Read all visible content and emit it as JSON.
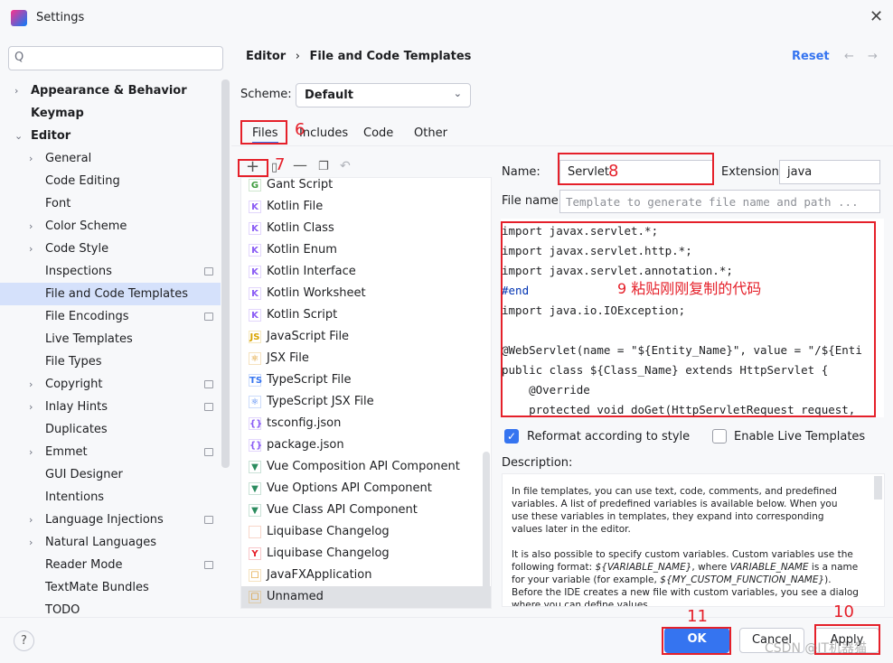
{
  "window": {
    "title": "Settings"
  },
  "search": {
    "placeholder": "Q"
  },
  "sidebar": {
    "items": [
      {
        "label": "Appearance & Behavior",
        "bold": true,
        "chevron": "right",
        "level": 0
      },
      {
        "label": "Keymap",
        "bold": true,
        "level": 0
      },
      {
        "label": "Editor",
        "bold": true,
        "chevron": "down",
        "level": 0
      },
      {
        "label": "General",
        "chevron": "right",
        "level": 1
      },
      {
        "label": "Code Editing",
        "level": 1
      },
      {
        "label": "Font",
        "level": 1
      },
      {
        "label": "Color Scheme",
        "chevron": "right",
        "level": 1
      },
      {
        "label": "Code Style",
        "chevron": "right",
        "level": 1
      },
      {
        "label": "Inspections",
        "badge": true,
        "level": 1
      },
      {
        "label": "File and Code Templates",
        "selected": true,
        "level": 1
      },
      {
        "label": "File Encodings",
        "badge": true,
        "level": 1
      },
      {
        "label": "Live Templates",
        "level": 1
      },
      {
        "label": "File Types",
        "level": 1
      },
      {
        "label": "Copyright",
        "chevron": "right",
        "badge": true,
        "level": 1
      },
      {
        "label": "Inlay Hints",
        "chevron": "right",
        "badge": true,
        "level": 1
      },
      {
        "label": "Duplicates",
        "level": 1
      },
      {
        "label": "Emmet",
        "chevron": "right",
        "badge": true,
        "level": 1
      },
      {
        "label": "GUI Designer",
        "level": 1
      },
      {
        "label": "Intentions",
        "level": 1
      },
      {
        "label": "Language Injections",
        "chevron": "right",
        "badge": true,
        "level": 1
      },
      {
        "label": "Natural Languages",
        "chevron": "right",
        "level": 1
      },
      {
        "label": "Reader Mode",
        "badge": true,
        "level": 1
      },
      {
        "label": "TextMate Bundles",
        "level": 1
      },
      {
        "label": "TODO",
        "level": 1
      }
    ]
  },
  "breadcrumb": {
    "parent": "Editor",
    "sep": "›",
    "current": "File and Code Templates"
  },
  "header": {
    "reset": "Reset"
  },
  "scheme": {
    "label": "Scheme:",
    "value": "Default"
  },
  "tabs": [
    "Files",
    "Includes",
    "Code",
    "Other"
  ],
  "annotations": {
    "a6": "6",
    "a7": "7",
    "a8": "8",
    "a9": "9 粘贴刚刚复制的代码",
    "a10": "10",
    "a11": "11"
  },
  "templates": [
    {
      "label": "Gant Script",
      "icon": "G",
      "color": "#3f9b3f"
    },
    {
      "label": "Kotlin File",
      "icon": "K",
      "color": "#8a5cf5"
    },
    {
      "label": "Kotlin Class",
      "icon": "K",
      "color": "#8a5cf5"
    },
    {
      "label": "Kotlin Enum",
      "icon": "K",
      "color": "#8a5cf5"
    },
    {
      "label": "Kotlin Interface",
      "icon": "K",
      "color": "#8a5cf5"
    },
    {
      "label": "Kotlin Worksheet",
      "icon": "K",
      "color": "#8a5cf5"
    },
    {
      "label": "Kotlin Script",
      "icon": "K",
      "color": "#8a5cf5"
    },
    {
      "label": "JavaScript File",
      "icon": "JS",
      "color": "#d9a400"
    },
    {
      "label": "JSX File",
      "icon": "⚛",
      "color": "#d98a00"
    },
    {
      "label": "TypeScript File",
      "icon": "TS",
      "color": "#3574f0"
    },
    {
      "label": "TypeScript JSX File",
      "icon": "⚛",
      "color": "#3574f0"
    },
    {
      "label": "tsconfig.json",
      "icon": "{}",
      "color": "#8a5cf5"
    },
    {
      "label": "package.json",
      "icon": "{}",
      "color": "#8a5cf5"
    },
    {
      "label": "Vue Composition API Component",
      "icon": "▼",
      "color": "#2c8c5f"
    },
    {
      "label": "Vue Options API Component",
      "icon": "▼",
      "color": "#2c8c5f"
    },
    {
      "label": "Vue Class API Component",
      "icon": "▼",
      "color": "#2c8c5f"
    },
    {
      "label": "Liquibase Changelog",
      "icon": "</>",
      "color": "#e55b2a"
    },
    {
      "label": "Liquibase Changelog",
      "icon": "Y",
      "color": "#e5202a"
    },
    {
      "label": "JavaFXApplication",
      "icon": "☐",
      "color": "#d98a00"
    },
    {
      "label": "Unnamed",
      "icon": "☐",
      "color": "#d98a00",
      "selected": true
    }
  ],
  "form": {
    "name_label": "Name:",
    "name_value": "Servlet",
    "ext_label": "Extension:",
    "ext_value": "java",
    "filename_label": "File name:",
    "filename_placeholder": "Template to generate file name and path ..."
  },
  "code_lines": [
    "import javax.servlet.*;",
    "import javax.servlet.http.*;",
    "import javax.servlet.annotation.*;",
    "#end",
    "import java.io.IOException;",
    "",
    "@WebServlet(name = \"${Entity_Name}\", value = \"/${Enti",
    "public class ${Class_Name} extends HttpServlet {",
    "    @Override",
    "    protected void doGet(HttpServletRequest request,"
  ],
  "options": {
    "reformat": "Reformat according to style",
    "reformat_checked": true,
    "live": "Enable Live Templates",
    "live_checked": false
  },
  "description": {
    "label": "Description:",
    "p1": "In file templates, you can use text, code, comments, and predefined variables. A list of predefined variables is available below. When you use these variables in templates, they expand into corresponding values later in the editor.",
    "p2a": "It is also possible to specify custom variables. Custom variables use the following format: ",
    "p2v1": "${VARIABLE_NAME}",
    "p2b": ", where ",
    "p2v2": "VARIABLE_NAME",
    "p2c": " is a name for your variable (for example, ",
    "p2v3": "${MY_CUSTOM_FUNCTION_NAME}",
    "p2d": "). Before the IDE creates a new file with custom variables, you see a dialog where you can define values"
  },
  "buttons": {
    "ok": "OK",
    "cancel": "Cancel",
    "apply": "Apply",
    "help": "?"
  },
  "watermark": "CSDN @IT机器猫",
  "colors": {
    "accent": "#3574f0",
    "annotation": "#e5202a",
    "selection": "#d5e1fb"
  }
}
